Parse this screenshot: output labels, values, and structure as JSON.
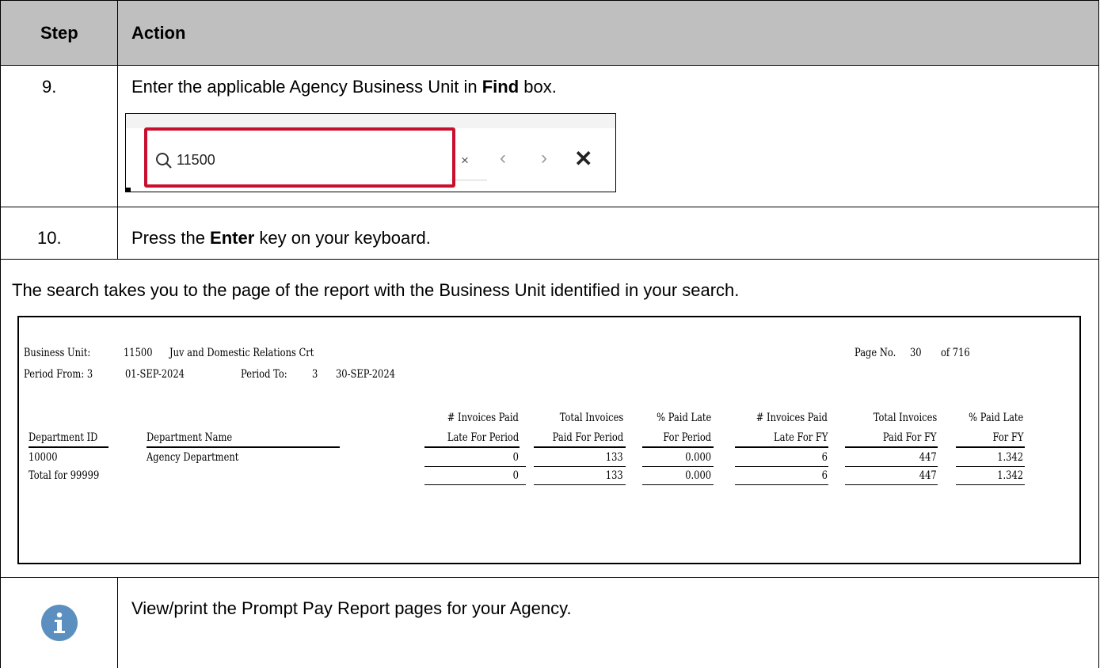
{
  "table": {
    "col_step": "Step",
    "col_action": "Action",
    "rows": [
      {
        "step": "9.",
        "action_parts": [
          "Enter the applicable Agency Business Unit in ",
          "Find",
          " box."
        ]
      },
      {
        "step": "10.",
        "action_parts": [
          "Press the ",
          "Enter",
          " key on your keyboard."
        ]
      }
    ],
    "note": "The search takes you to the page of the report with the Business Unit identified in your search.",
    "info_text": "View/print the Prompt Pay Report pages for your Agency."
  },
  "find_bar": {
    "query": "11500",
    "icons": [
      "search-icon",
      "clear-icon",
      "chevron-left-icon",
      "chevron-right-icon",
      "close-icon"
    ],
    "highlight_color": "#c8102e"
  },
  "report": {
    "bu_label": "Business Unit:",
    "bu_value": "11500",
    "bu_name": "Juv and Domestic Relations Crt",
    "page_label": "Page No.",
    "page_value": "30",
    "page_of": "of 716",
    "period_from_label": "Period From: 3",
    "period_from_date": "01-SEP-2024",
    "period_to_label": "Period To:",
    "period_to_value": "3",
    "period_to_date": "30-SEP-2024",
    "columns": [
      {
        "line1": "# Invoices Paid",
        "line2": "Late For Period"
      },
      {
        "line1": "Total Invoices",
        "line2": "Paid For Period"
      },
      {
        "line1": "% Paid Late",
        "line2": "For Period"
      },
      {
        "line1": "# Invoices Paid",
        "line2": "Late For FY"
      },
      {
        "line1": "Total Invoices",
        "line2": "Paid For FY"
      },
      {
        "line1": "% Paid Late",
        "line2": "For FY"
      }
    ],
    "dept_id_header": "Department ID",
    "dept_name_header": "Department Name",
    "rows": [
      {
        "id": "10000",
        "name": "Agency Department",
        "values": [
          "0",
          "133",
          "0.000",
          "6",
          "447",
          "1.342"
        ]
      },
      {
        "id": "Total for 99999",
        "name": "",
        "values": [
          "0",
          "133",
          "0.000",
          "6",
          "447",
          "1.342"
        ]
      }
    ]
  },
  "colors": {
    "header_bg": "#bfbfbf",
    "info_icon": "#5b8fbf"
  }
}
